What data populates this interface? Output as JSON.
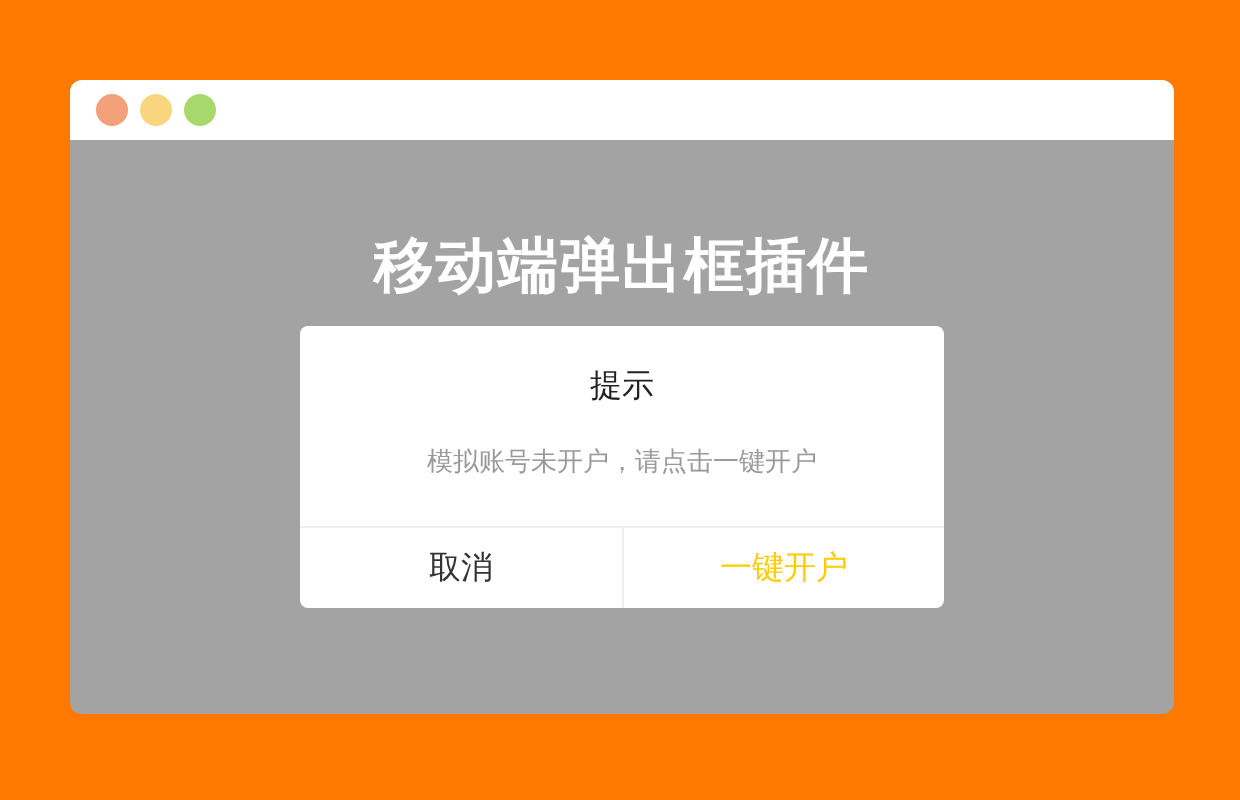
{
  "window": {
    "controls": [
      {
        "color": "#f4a07a"
      },
      {
        "color": "#f8d57e"
      },
      {
        "color": "#a6d86c"
      }
    ]
  },
  "heading": "移动端弹出框插件",
  "dialog": {
    "title": "提示",
    "message": "模拟账号未开户，请点击一键开户",
    "buttons": [
      {
        "label": "取消",
        "kind": "cancel"
      },
      {
        "label": "一键开户",
        "kind": "confirm"
      }
    ]
  }
}
